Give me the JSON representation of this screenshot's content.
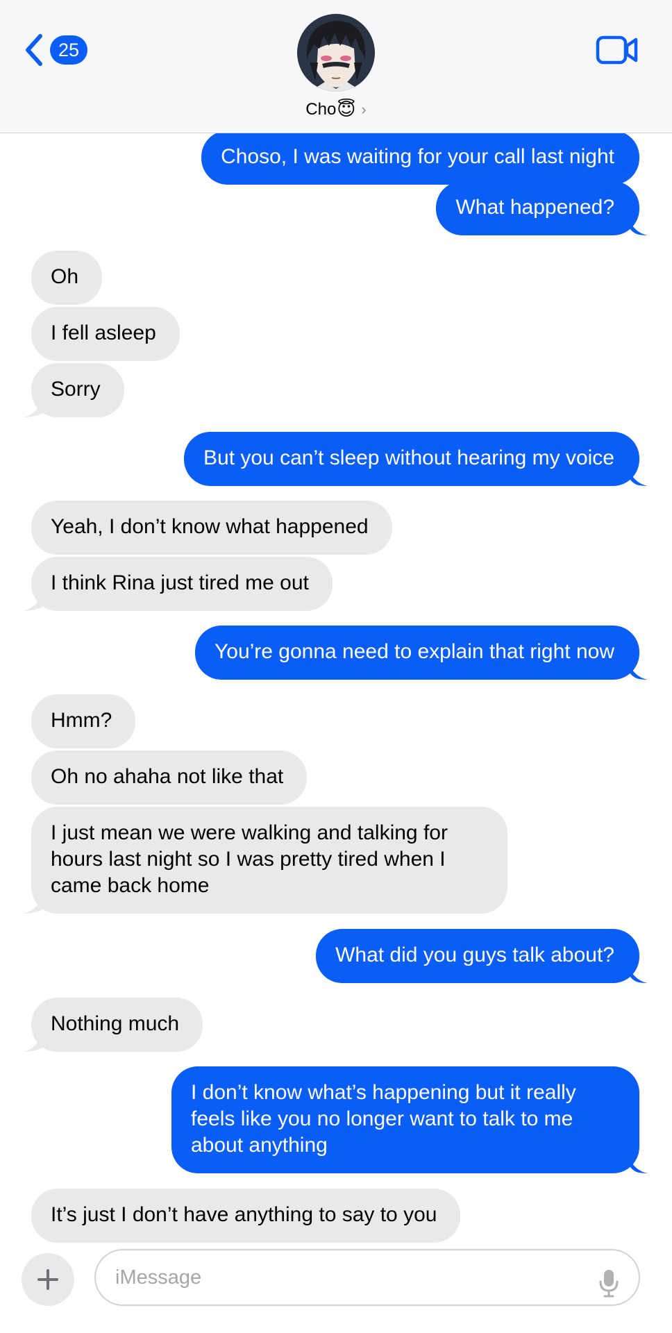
{
  "header": {
    "unread_count": "25",
    "contact_name": "Cho",
    "contact_emoji": "😇",
    "contact_chevron": "›"
  },
  "messages": [
    {
      "from": "me",
      "text": "Choso, I was waiting for your call last night"
    },
    {
      "from": "me",
      "text": "What happened?"
    },
    {
      "from": "them",
      "text": "Oh"
    },
    {
      "from": "them",
      "text": "I fell asleep"
    },
    {
      "from": "them",
      "text": "Sorry"
    },
    {
      "from": "me",
      "text": "But you can’t sleep without hearing my voice"
    },
    {
      "from": "them",
      "text": "Yeah, I don’t know what happened"
    },
    {
      "from": "them",
      "text": "I think Rina just tired me out"
    },
    {
      "from": "me",
      "text": "You’re gonna need to explain that right now"
    },
    {
      "from": "them",
      "text": "Hmm?"
    },
    {
      "from": "them",
      "text": "Oh no ahaha not like that"
    },
    {
      "from": "them",
      "text": "I just mean we were walking and talking for hours last night so I was pretty tired when I came back home"
    },
    {
      "from": "me",
      "text": "What did you guys talk about?"
    },
    {
      "from": "them",
      "text": "Nothing much"
    },
    {
      "from": "me",
      "text": "I don’t know what’s happening but it really feels like you no longer want to talk to me about anything"
    },
    {
      "from": "them",
      "text": "It’s just I don’t have anything to say to you"
    }
  ],
  "composer": {
    "placeholder": "iMessage"
  },
  "colors": {
    "sent_bubble": "#0b5ef5",
    "received_bubble": "#e9e9eb",
    "accent": "#0b5ef5"
  },
  "icons": {
    "back": "chevron-left-icon",
    "video": "video-camera-icon",
    "plus": "plus-icon",
    "mic": "microphone-icon"
  }
}
